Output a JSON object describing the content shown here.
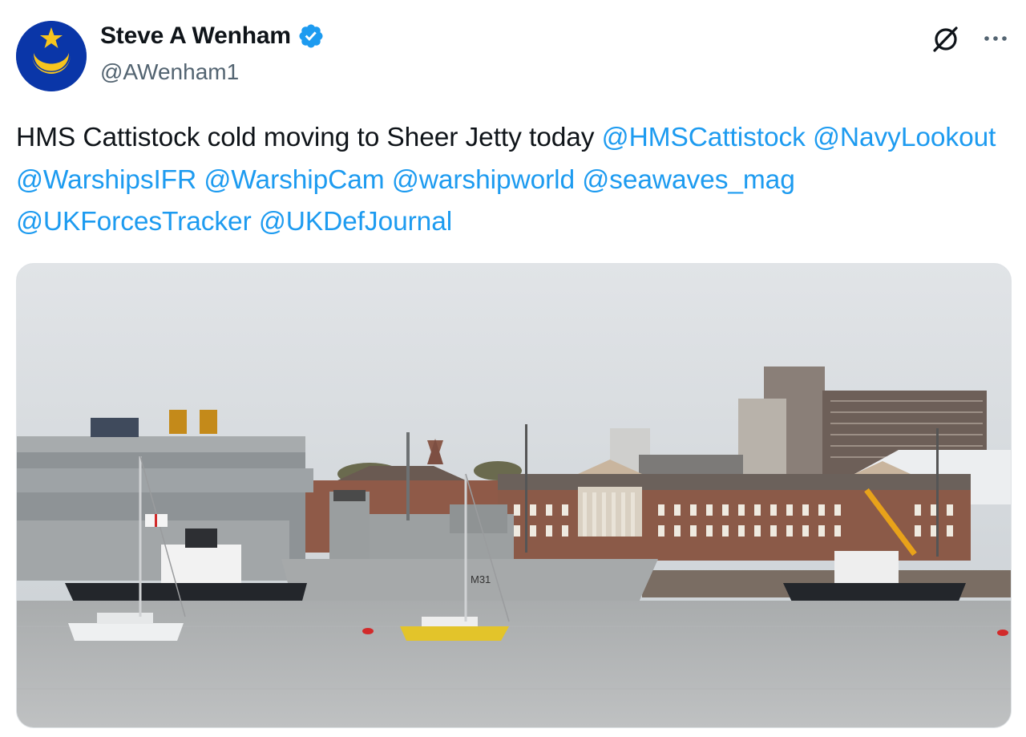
{
  "author": {
    "display_name": "Steve A Wenham",
    "handle": "@AWenham1",
    "verified": true,
    "avatar_icon": "star-and-crescent-icon",
    "avatar_bg": "#0a36a8",
    "avatar_emblem": "#f7c51e"
  },
  "header_actions": {
    "grok_icon": "grok-icon",
    "more_icon": "more-icon"
  },
  "tweet": {
    "text": "HMS Cattistock cold moving to Sheer Jetty today ",
    "mentions": [
      "@HMSCattistock",
      "@NavyLookout",
      "@WarshipsIFR",
      "@WarshipCam",
      "@warshipworld",
      "@seawaves_mag",
      "@UKForcesTracker",
      "@UKDefJournal"
    ]
  },
  "media": {
    "hull_number": "M31",
    "accent_color": "#1d9bf0"
  }
}
